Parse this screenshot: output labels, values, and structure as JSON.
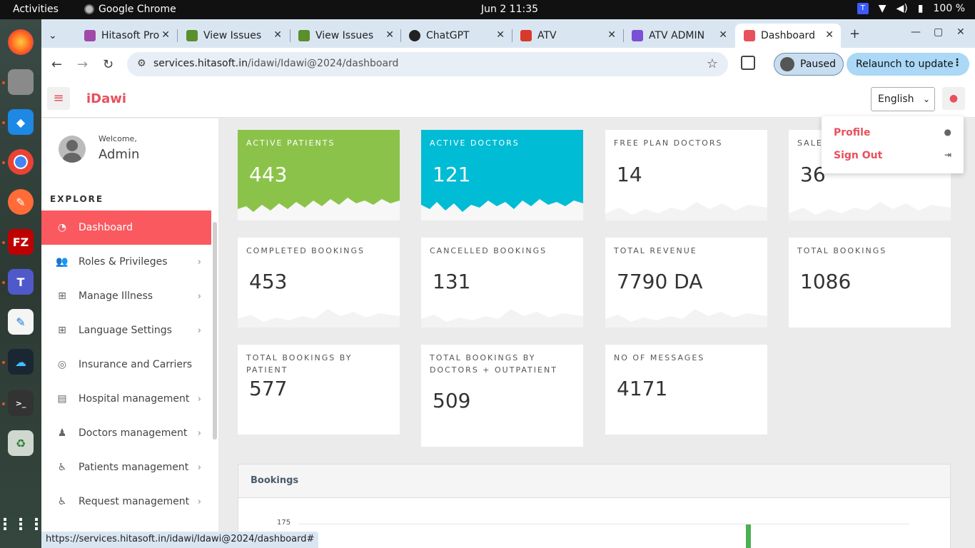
{
  "topbar": {
    "activities": "Activities",
    "app_name": "Google Chrome",
    "clock": "Jun 2  11:35",
    "battery": "100 %"
  },
  "tabs": [
    {
      "title": "Hitasoft Pro",
      "color": "#a04aa8"
    },
    {
      "title": "View Issues",
      "color": "#5a8f2b"
    },
    {
      "title": "View Issues",
      "color": "#5a8f2b"
    },
    {
      "title": "ChatGPT",
      "color": "#222222"
    },
    {
      "title": "ATV",
      "color": "#d73a2a"
    },
    {
      "title": "ATV ADMIN",
      "color": "#7b4fd6"
    },
    {
      "title": "Dashboard",
      "color": "#e8505b"
    }
  ],
  "omnibox": {
    "host": "services.hitasoft.in",
    "path": "/idawi/Idawi@2024/dashboard"
  },
  "profile_button": "Paused",
  "relaunch_button": "Relaunch to update",
  "header": {
    "brand": "iDawi",
    "language": "English"
  },
  "user_menu": {
    "profile": "Profile",
    "sign_out": "Sign Out"
  },
  "sidebar": {
    "welcome": "Welcome,",
    "user": "Admin",
    "section": "EXPLORE",
    "items": [
      {
        "label": "Dashboard",
        "icon": "dashboard-icon"
      },
      {
        "label": "Roles & Privileges",
        "icon": "users-icon"
      },
      {
        "label": "Manage Illness",
        "icon": "medkit-icon"
      },
      {
        "label": "Language Settings",
        "icon": "medkit-icon"
      },
      {
        "label": "Insurance and Carriers",
        "icon": "lifebuoy-icon"
      },
      {
        "label": "Hospital management",
        "icon": "clipboard-icon"
      },
      {
        "label": "Doctors management",
        "icon": "doctor-icon"
      },
      {
        "label": "Patients management",
        "icon": "wheelchair-icon"
      },
      {
        "label": "Request management",
        "icon": "wheelchair-icon"
      }
    ]
  },
  "stats": [
    {
      "label": "ACTIVE PATIENTS",
      "value": "443"
    },
    {
      "label": "ACTIVE DOCTORS",
      "value": "121"
    },
    {
      "label": "FREE PLAN DOCTORS",
      "value": "14"
    },
    {
      "label": "SALE",
      "value": "36"
    },
    {
      "label": "COMPLETED BOOKINGS",
      "value": "453"
    },
    {
      "label": "CANCELLED BOOKINGS",
      "value": "131"
    },
    {
      "label": "TOTAL REVENUE",
      "value": "7790 DA"
    },
    {
      "label": "TOTAL BOOKINGS",
      "value": "1086"
    },
    {
      "label": "TOTAL BOOKINGS BY PATIENT",
      "value": "577"
    },
    {
      "label": "TOTAL BOOKINGS BY DOCTORS + OUTPATIENT",
      "value": "509"
    },
    {
      "label": "NO OF MESSAGES",
      "value": "4171"
    }
  ],
  "bookings": {
    "title": "Bookings",
    "y_tick": "175"
  },
  "status_url": "https://services.hitasoft.in/idawi/Idawi@2024/dashboard#"
}
